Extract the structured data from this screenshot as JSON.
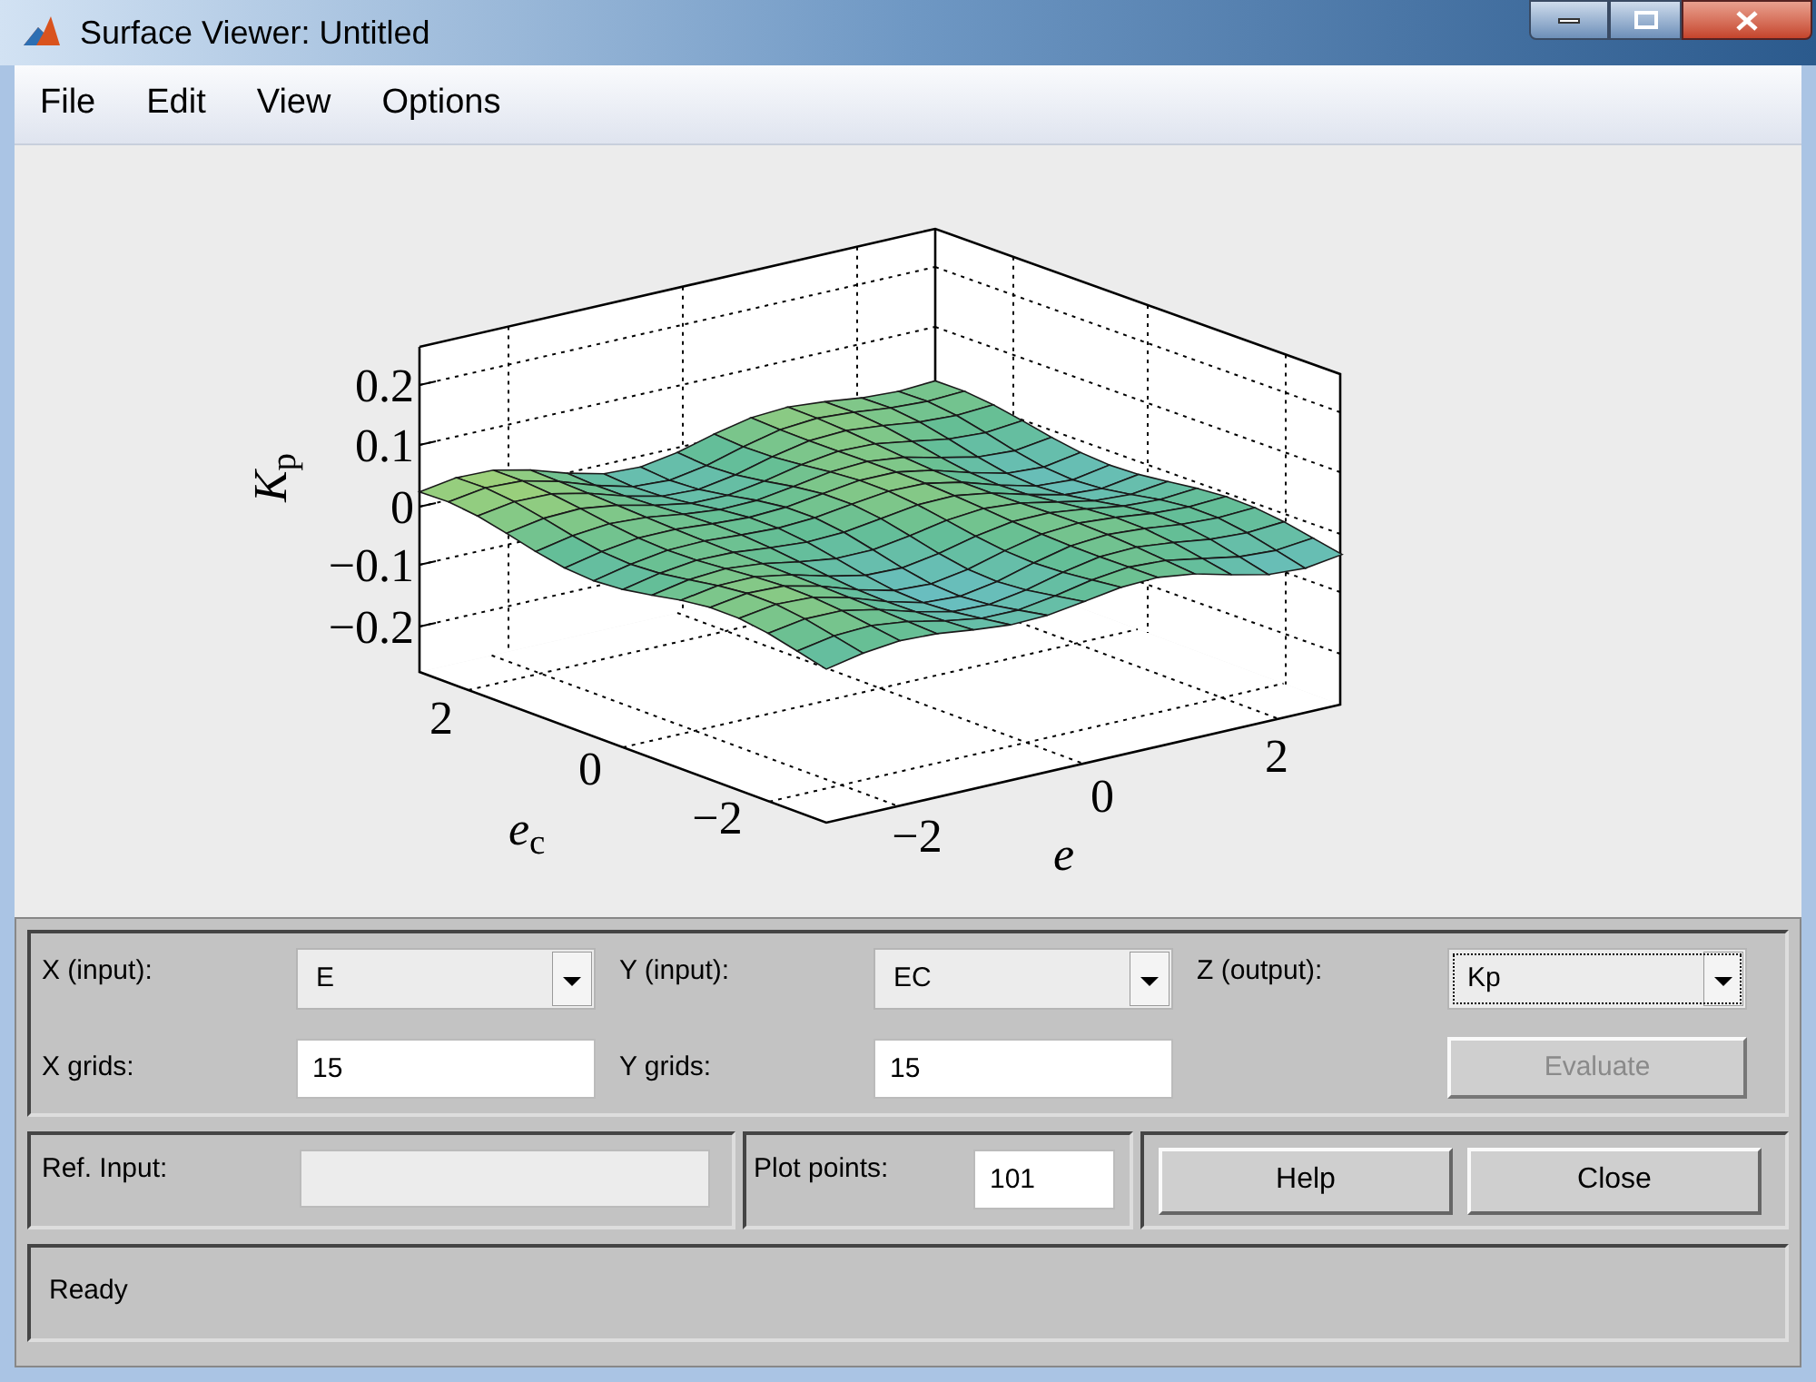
{
  "window": {
    "title": "Surface Viewer: Untitled"
  },
  "menu": [
    {
      "label": "File"
    },
    {
      "label": "Edit"
    },
    {
      "label": "View"
    },
    {
      "label": "Options"
    }
  ],
  "plot": {
    "zlabel": "*K*$_{p}$",
    "xlabel": "*e*$_{c}$",
    "ylabel": "e",
    "zticks": [
      "0.2",
      "0.1",
      "0",
      "−0.1",
      "−0.2"
    ],
    "xticks": [
      "2",
      "0",
      "−2"
    ],
    "yticks": [
      "−2",
      "0",
      "2"
    ]
  },
  "x_input": {
    "label": "X (input):",
    "value": "E"
  },
  "y_input": {
    "label": "Y (input):",
    "value": "EC"
  },
  "z_output": {
    "label": "Z (output):",
    "value": "Kp",
    "focused": true
  },
  "x_grids": {
    "label": "X grids:",
    "value": "15"
  },
  "y_grids": {
    "label": "Y grids:",
    "value": "15"
  },
  "evaluate": {
    "label": "Evaluate",
    "disabled": true
  },
  "ref_input": {
    "label": "Ref. Input:",
    "disabled": true
  },
  "plot_points": {
    "label": "Plot points:",
    "value": "101"
  },
  "buttons": [
    "Help",
    "Close"
  ],
  "status": "Ready"
}
